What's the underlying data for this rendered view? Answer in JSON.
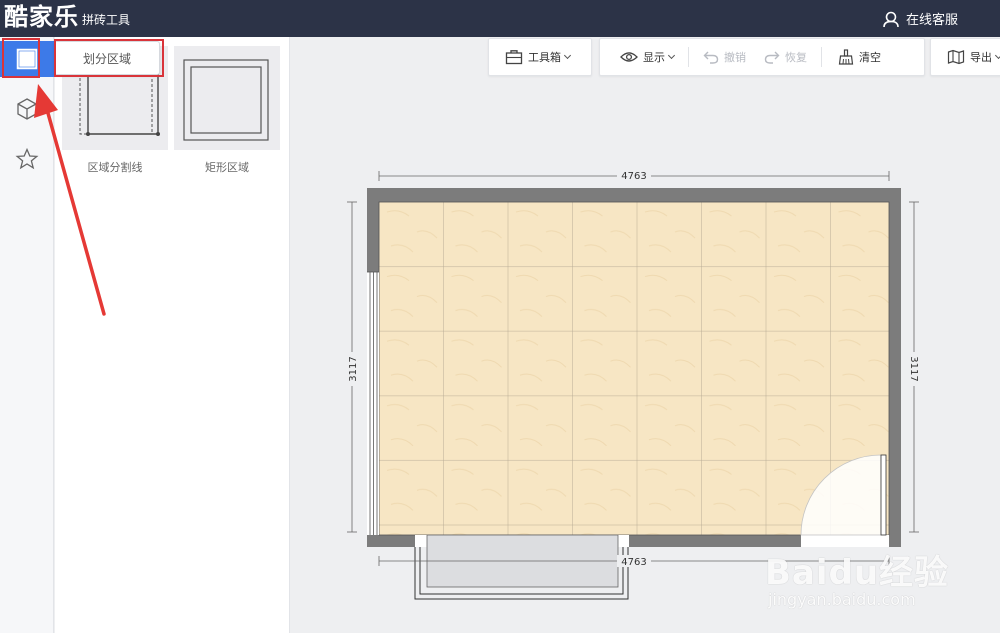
{
  "app": {
    "brand_main": "酷家乐",
    "brand_sub": "拼砖工具",
    "customer_service": "在线客服"
  },
  "sidebar": {
    "active_tooltip": "划分区域",
    "items": [
      {
        "icon": "square-icon",
        "active": true
      },
      {
        "icon": "cube-icon",
        "active": false
      },
      {
        "icon": "star-icon",
        "active": false
      }
    ]
  },
  "panel": {
    "cards": [
      {
        "label": "区域分割线"
      },
      {
        "label": "矩形区域"
      }
    ]
  },
  "toolbar": {
    "toolbox": "工具箱",
    "display": "显示",
    "undo": "撤销",
    "redo": "恢复",
    "clear": "清空",
    "export": "导出"
  },
  "floorplan": {
    "width_top": "4763",
    "width_bottom": "4763",
    "height_left": "3117",
    "height_right": "3117"
  },
  "watermark": {
    "main": "Baidu经验",
    "sub": "jingyan.baidu.com"
  },
  "colors": {
    "topbar": "#2c3347",
    "accent": "#3d7ae8",
    "highlight": "#d9343a",
    "wall": "#7c7c7c",
    "tile": "#f7e6c4"
  }
}
